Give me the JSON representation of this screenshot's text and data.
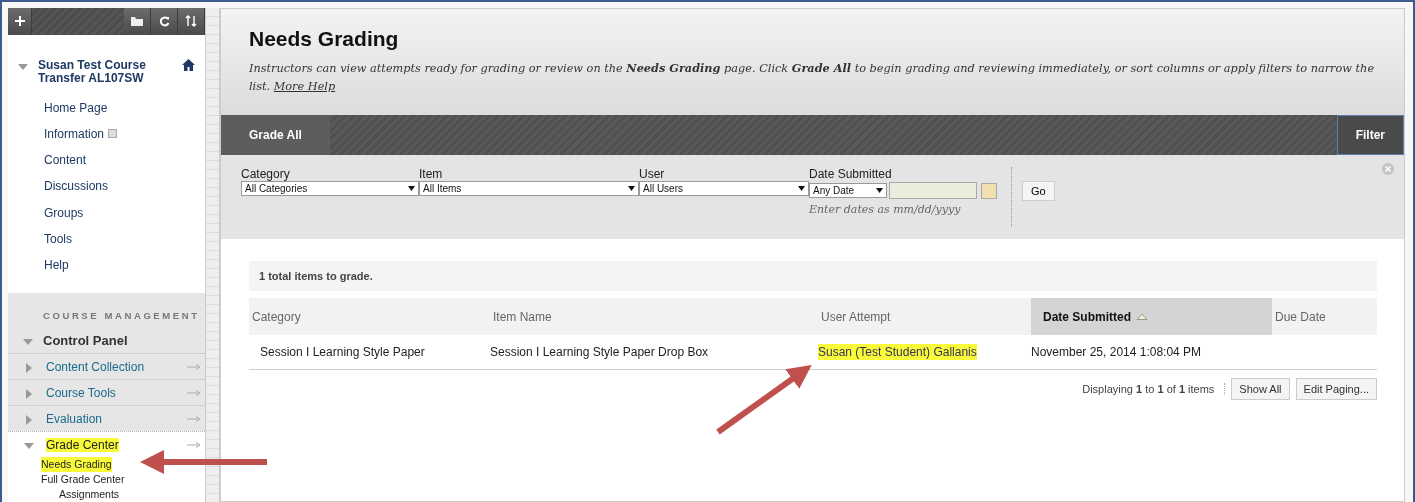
{
  "sidebar": {
    "toolbar": [
      {
        "kind": "add"
      },
      {
        "kind": "folder"
      },
      {
        "kind": "refresh"
      },
      {
        "kind": "sort"
      }
    ],
    "course": {
      "title": "Susan Test Course Transfer AL107SW",
      "expanded": true
    },
    "items": [
      {
        "label": "Home Page",
        "kind": "link"
      },
      {
        "label": "Information",
        "kind": "folder"
      },
      {
        "label": "Content",
        "kind": "link"
      },
      {
        "label": "Discussions",
        "kind": "link"
      },
      {
        "label": "Groups",
        "kind": "link"
      },
      {
        "label": "Tools",
        "kind": "link"
      },
      {
        "label": "Help",
        "kind": "link"
      }
    ],
    "management_heading": "COURSE MANAGEMENT",
    "control_panel": {
      "label": "Control Panel",
      "expanded": true
    },
    "sections": [
      {
        "label": "Content Collection",
        "expanded": false,
        "highlighted": false
      },
      {
        "label": "Course Tools",
        "expanded": false,
        "highlighted": false
      },
      {
        "label": "Evaluation",
        "expanded": false,
        "highlighted": false
      },
      {
        "label": "Grade Center",
        "expanded": true,
        "highlighted": true,
        "children": [
          {
            "label": "Needs Grading",
            "highlighted": true
          },
          {
            "label": "Full Grade Center",
            "highlighted": false
          },
          {
            "label": "Assignments",
            "highlighted": false
          }
        ]
      }
    ]
  },
  "main": {
    "title": "Needs Grading",
    "description": "Instructors can view attempts ready for grading or review on the **Needs Grading** page. Click **Grade All** to begin grading and reviewing immediately, or sort columns or apply filters to narrow the list.",
    "help_link": "More Help",
    "action_bar": {
      "primary": "Grade All",
      "filter": "Filter"
    },
    "filters": [
      {
        "label": "Category",
        "value": "All Categories"
      },
      {
        "label": "Item",
        "value": "All Items"
      },
      {
        "label": "User",
        "value": "All Users"
      }
    ],
    "date_filter": {
      "label": "Date Submitted",
      "value": "Any Date",
      "hint": "Enter dates as mm/dd/yyyy"
    },
    "go": "Go",
    "summary": "1 total items to grade.",
    "table": {
      "columns": [
        {
          "label": "Category",
          "sorted": false
        },
        {
          "label": "Item Name",
          "sorted": false
        },
        {
          "label": "User Attempt",
          "sorted": false
        },
        {
          "label": "Date Submitted",
          "sorted": true
        },
        {
          "label": "Due Date",
          "sorted": false
        }
      ],
      "rows": [
        {
          "cells": [
            {
              "text": "Session I Learning Style Paper",
              "highlighted": false
            },
            {
              "text": "Session I Learning Style Paper Drop Box",
              "highlighted": false
            },
            {
              "text": "Susan (Test Student) Gallanis",
              "highlighted": true
            },
            {
              "text": "November 25, 2014 1:08:04 PM",
              "highlighted": false
            }
          ]
        }
      ]
    },
    "paging": {
      "text": "Displaying **1** to **1** of **1** items",
      "buttons": [
        "Show All",
        "Edit Paging..."
      ]
    }
  }
}
